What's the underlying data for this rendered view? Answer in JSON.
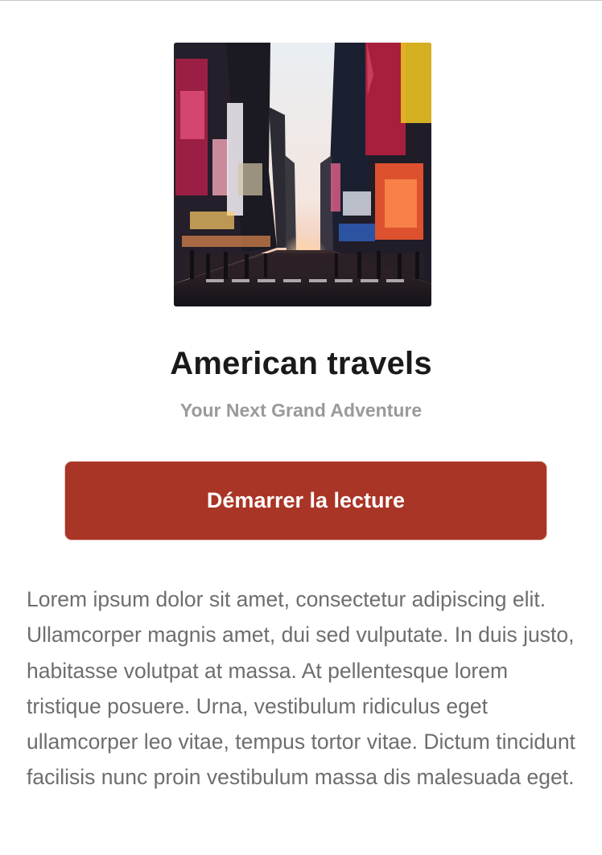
{
  "book": {
    "cover_image": "times-square-street-photo",
    "title": "American travels",
    "subtitle": "Your Next Grand Adventure",
    "description": "Lorem ipsum dolor sit amet, consectetur adipiscing elit. Ullamcorper magnis amet, dui sed vulputate. In duis justo, habitasse volutpat at massa. At pellentesque lorem tristique posuere. Urna, vestibulum ridiculus eget ullamcorper leo vitae, tempus tortor vitae. Dictum tincidunt facilisis nunc proin vestibulum massa dis malesuada eget."
  },
  "actions": {
    "start_reading_label": "Démarrer la lecture"
  },
  "colors": {
    "accent": "#a93526",
    "title_text": "#1a1a1a",
    "subtitle_text": "#9a9a9a",
    "body_text": "#6e6e6e"
  }
}
